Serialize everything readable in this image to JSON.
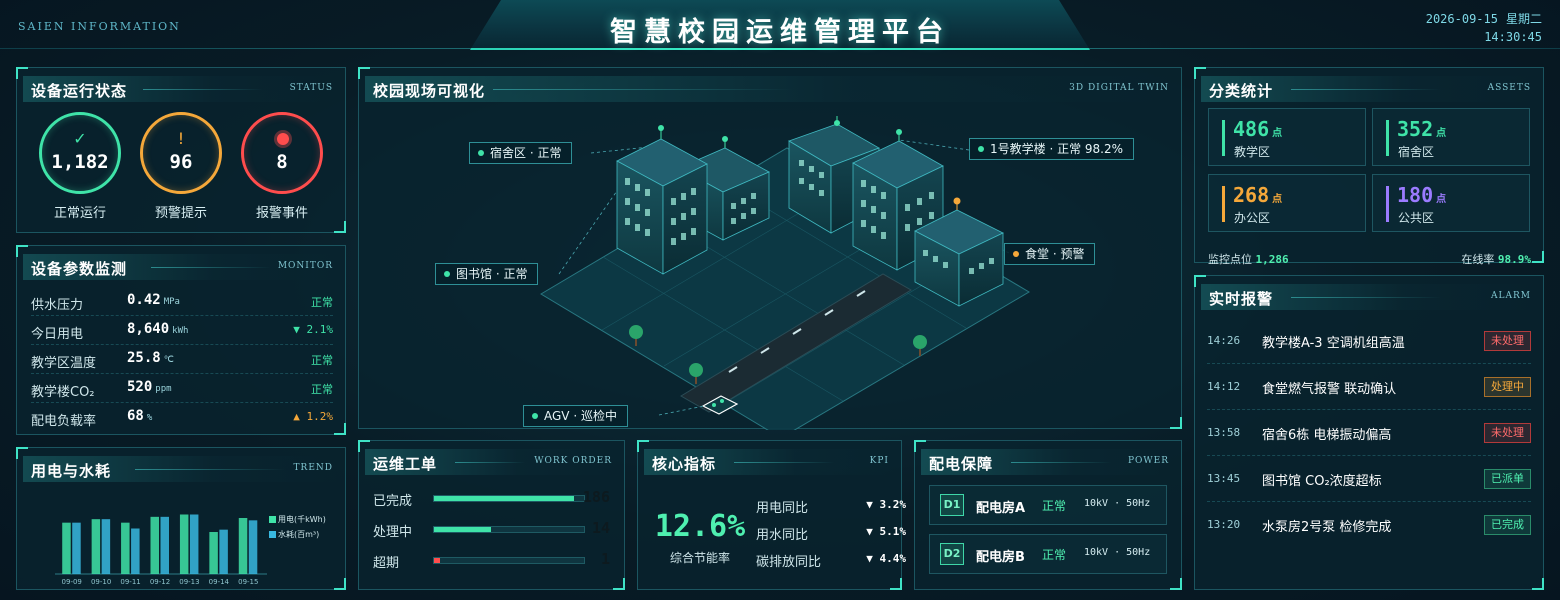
{
  "header": {
    "brand": "SAIEN INFORMATION",
    "title": "智慧校园运维管理平台",
    "date": "2026-09-15",
    "weekday": "星期二",
    "time": "14:30:45"
  },
  "colors": {
    "normal": "#3fe3a8",
    "warning": "#f5a83a",
    "alarm": "#ff4d4d",
    "accent": "#3fe3c6",
    "purple": "#9b7bff"
  },
  "status_panel": {
    "title": "设备运行状态",
    "tag": "STATUS",
    "rings": [
      {
        "icon": "check-icon",
        "symbol": "✓",
        "value": "1,182",
        "label": "正常运行"
      },
      {
        "icon": "warning-icon",
        "symbol": "!",
        "value": "96",
        "label": "预警提示"
      },
      {
        "icon": "alarm-dot-icon",
        "symbol": "",
        "value": "8",
        "label": "报警事件"
      }
    ]
  },
  "monitor_panel": {
    "title": "设备参数监测",
    "tag": "MONITOR",
    "rows": [
      {
        "key": "供水压力",
        "value": "0.42",
        "unit": "MPa",
        "status": "正常",
        "status_type": "normal"
      },
      {
        "key": "今日用电",
        "value": "8,640",
        "unit": "kWh",
        "status": "▼ 2.1%",
        "status_type": "normal"
      },
      {
        "key": "教学区温度",
        "value": "25.8",
        "unit": "℃",
        "status": "正常",
        "status_type": "normal"
      },
      {
        "key": "教学楼CO₂",
        "value": "520",
        "unit": "ppm",
        "status": "正常",
        "status_type": "normal"
      },
      {
        "key": "配电负载率",
        "value": "68",
        "unit": "%",
        "status": "▲ 1.2%",
        "status_type": "warning"
      }
    ]
  },
  "trend_panel": {
    "title": "用电与水耗",
    "tag": "TREND",
    "legend": [
      "用电(千kWh)",
      "水耗(百m³)"
    ]
  },
  "chart_data": {
    "type": "bar",
    "categories": [
      "09-09",
      "09-10",
      "09-11",
      "09-12",
      "09-13",
      "09-14",
      "09-15"
    ],
    "series": [
      {
        "name": "用电(千kWh)",
        "values": [
          44,
          47,
          44,
          49,
          51,
          36,
          48
        ]
      },
      {
        "name": "水耗(百m³)",
        "values": [
          44,
          47,
          39,
          49,
          51,
          38,
          46
        ]
      }
    ],
    "ylim": [
      0,
      60
    ],
    "legend": "top-right",
    "grid": false
  },
  "map_panel": {
    "title": "校园现场可视化",
    "tag": "3D DIGITAL TWIN",
    "labels": [
      {
        "text": "宿舍区 · 正常",
        "type": "normal"
      },
      {
        "text": "1号教学楼 · 正常 98.2%",
        "type": "normal"
      },
      {
        "text": "图书馆 · 正常",
        "type": "normal"
      },
      {
        "text": "食堂 · 预警",
        "type": "warning"
      },
      {
        "text": "AGV · 巡检中",
        "type": "normal"
      }
    ]
  },
  "workorder_panel": {
    "title": "运维工单",
    "tag": "WORK ORDER",
    "rows": [
      {
        "key": "已完成",
        "count": "186",
        "fraction": 0.93,
        "type": "normal"
      },
      {
        "key": "处理中",
        "count": "14",
        "fraction": 0.38,
        "type": "normal"
      },
      {
        "key": "超期",
        "count": "1",
        "fraction": 0.04,
        "type": "alarm"
      }
    ]
  },
  "kpi_panel": {
    "title": "核心指标",
    "tag": "KPI",
    "big_value": "12.6%",
    "big_label": "综合节能率",
    "rows": [
      {
        "key": "用电同比",
        "value": "▼ 3.2%"
      },
      {
        "key": "用水同比",
        "value": "▼ 5.1%"
      },
      {
        "key": "碳排放同比",
        "value": "▼ 4.4%"
      }
    ]
  },
  "power_panel": {
    "title": "配电保障",
    "tag": "POWER",
    "rows": [
      {
        "badge": "D1",
        "name": "配电房A",
        "status": "正常",
        "spec": "10kV · 50Hz"
      },
      {
        "badge": "D2",
        "name": "配电房B",
        "status": "正常",
        "spec": "10kV · 50Hz"
      }
    ]
  },
  "assets_panel": {
    "title": "分类统计",
    "tag": "ASSETS",
    "items": [
      {
        "value": "486",
        "unit": "点",
        "label": "教学区",
        "color": "#3fe3a8"
      },
      {
        "value": "352",
        "unit": "点",
        "label": "宿舍区",
        "color": "#3fe3a8"
      },
      {
        "value": "268",
        "unit": "点",
        "label": "办公区",
        "color": "#f5a83a"
      },
      {
        "value": "180",
        "unit": "点",
        "label": "公共区",
        "color": "#9b7bff"
      }
    ],
    "foot_left_label": "监控点位",
    "foot_left_value": "1,286",
    "foot_right_label": "在线率",
    "foot_right_value": "98.9%"
  },
  "alarm_panel": {
    "title": "实时报警",
    "tag": "ALARM",
    "rows": [
      {
        "time": "14:26",
        "msg": "教学楼A-3 空调机组高温",
        "badge": "未处理",
        "type": "alarm"
      },
      {
        "time": "14:12",
        "msg": "食堂燃气报警 联动确认",
        "badge": "处理中",
        "type": "warning"
      },
      {
        "time": "13:58",
        "msg": "宿舍6栋 电梯振动偏高",
        "badge": "未处理",
        "type": "alarm"
      },
      {
        "time": "13:45",
        "msg": "图书馆 CO₂浓度超标",
        "badge": "已派单",
        "type": "normal"
      },
      {
        "time": "13:20",
        "msg": "水泵房2号泵 检修完成",
        "badge": "已完成",
        "type": "normal"
      }
    ]
  }
}
